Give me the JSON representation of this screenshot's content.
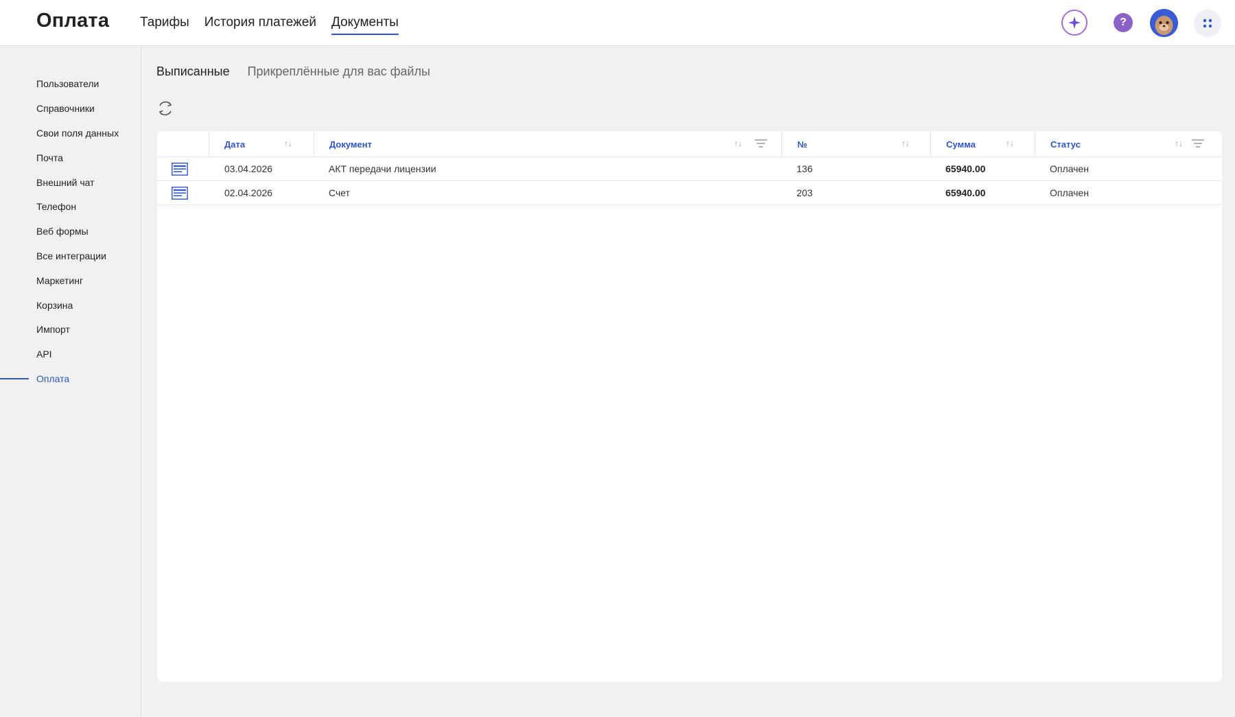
{
  "header": {
    "title": "Оплата",
    "tabs": [
      {
        "label": "Тарифы",
        "active": false
      },
      {
        "label": "История платежей",
        "active": false
      },
      {
        "label": "Документы",
        "active": true
      }
    ],
    "help_glyph": "?"
  },
  "sidebar": {
    "items": [
      {
        "label": "Пользователи"
      },
      {
        "label": "Справочники"
      },
      {
        "label": "Свои поля данных"
      },
      {
        "label": "Почта"
      },
      {
        "label": "Внешний чат"
      },
      {
        "label": "Телефон"
      },
      {
        "label": "Веб формы"
      },
      {
        "label": "Все интеграции"
      },
      {
        "label": "Маркетинг"
      },
      {
        "label": "Корзина"
      },
      {
        "label": "Импорт"
      },
      {
        "label": "API"
      },
      {
        "label": "Оплата"
      }
    ],
    "active_index": 12
  },
  "subtabs": [
    {
      "label": "Выписанные",
      "active": true
    },
    {
      "label": "Прикреплённые для вас файлы",
      "active": false
    }
  ],
  "table": {
    "columns": [
      {
        "label": "Дата"
      },
      {
        "label": "Документ"
      },
      {
        "label": "№"
      },
      {
        "label": "Сумма"
      },
      {
        "label": "Статус"
      }
    ],
    "rows": [
      {
        "date": "03.04.2026",
        "document": "АКТ передачи лицензии",
        "number": "136",
        "amount": "65940.00",
        "status": "Оплачен"
      },
      {
        "date": "02.04.2026",
        "document": "Счет",
        "number": "203",
        "amount": "65940.00",
        "status": "Оплачен"
      }
    ]
  },
  "colors": {
    "accent": "#2f56c9",
    "ai_ring": "#a66bd6",
    "help_bg": "#8a62c8"
  },
  "icons": {
    "ai": "sparkle-icon",
    "help": "question-icon",
    "apps": "grid-dots-icon",
    "refresh": "refresh-icon",
    "sort": "sort-arrows-icon",
    "filter": "filter-icon",
    "document": "document-icon"
  }
}
